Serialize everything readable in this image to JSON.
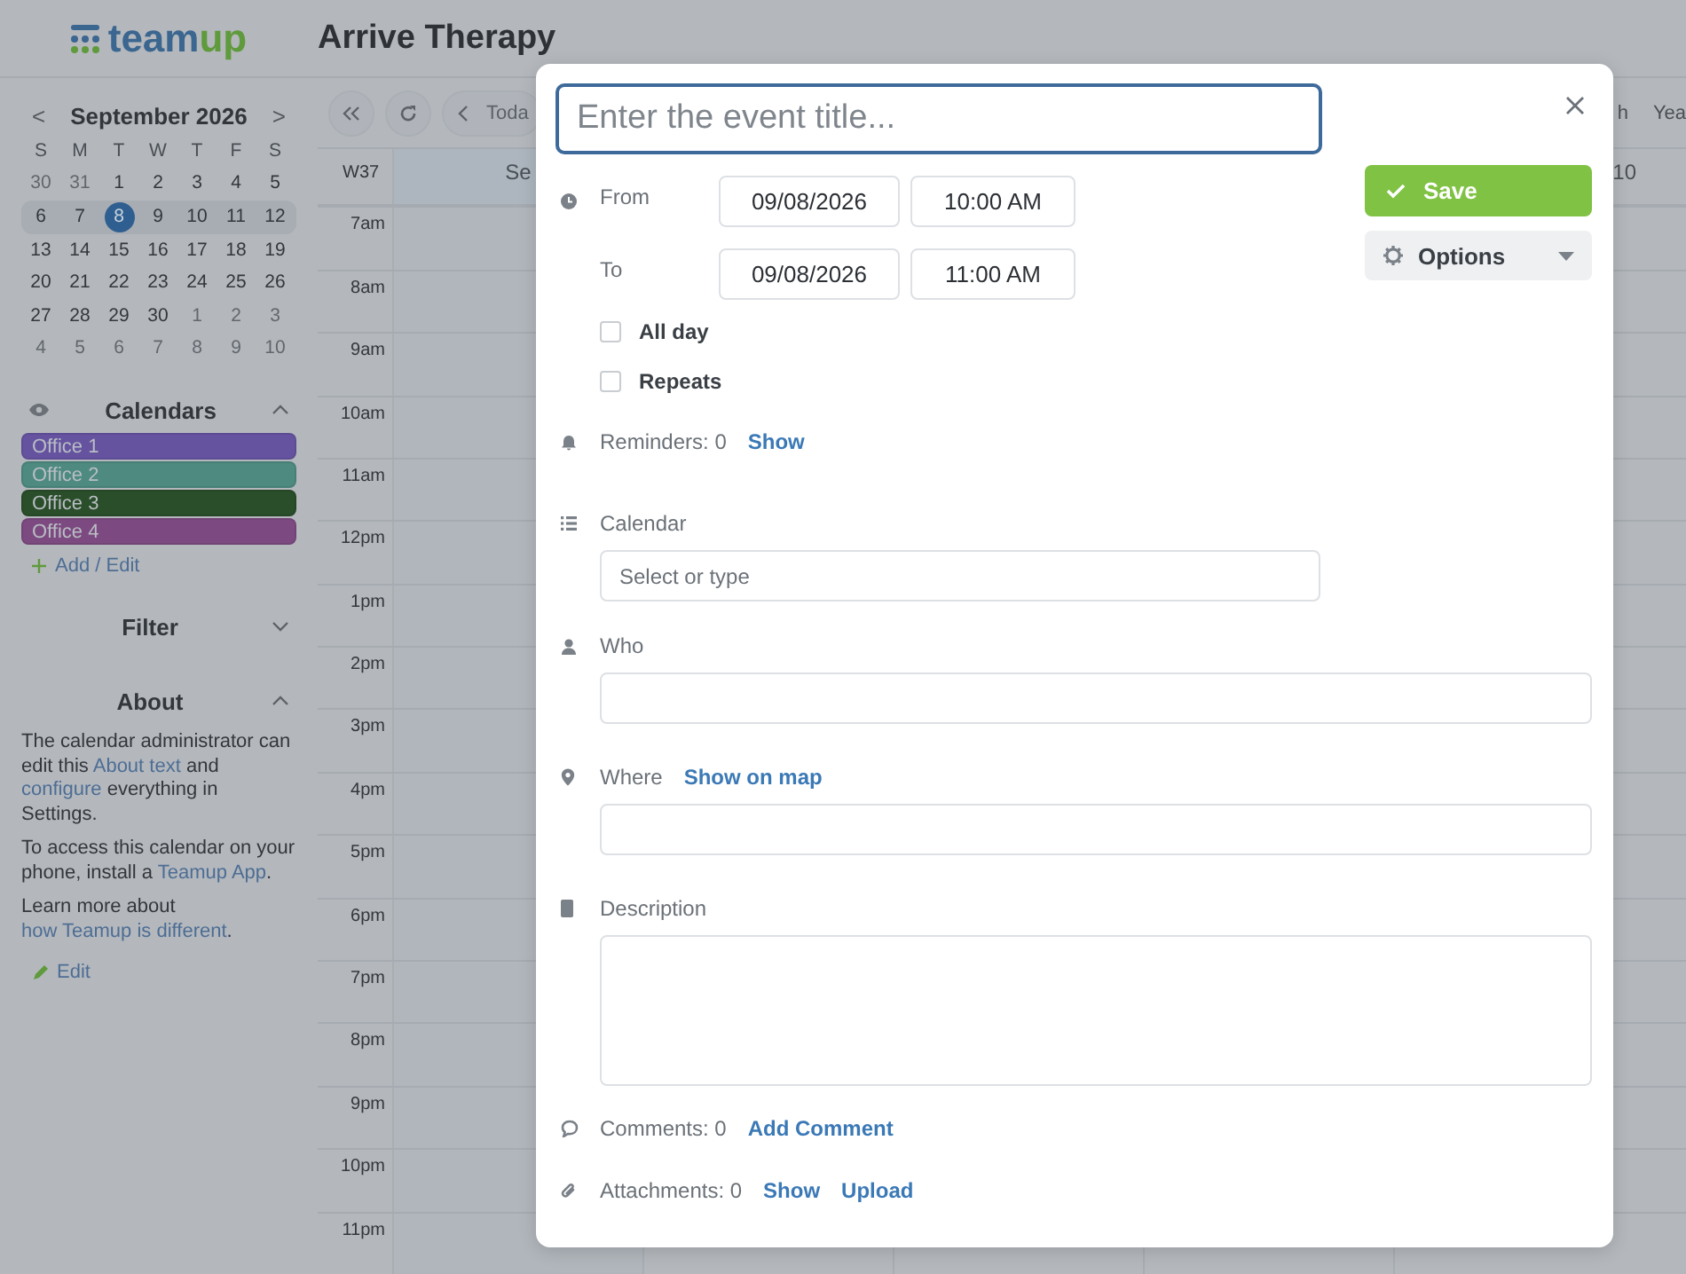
{
  "app": {
    "logo": [
      "team",
      "up"
    ],
    "title": "Arrive Therapy"
  },
  "mini_calendar": {
    "month": "September 2026",
    "prev": "<",
    "next": ">",
    "weekdays": [
      "S",
      "M",
      "T",
      "W",
      "T",
      "F",
      "S"
    ],
    "weeks": [
      {
        "days": [
          {
            "label": "30",
            "outside": true,
            "selected": false
          },
          {
            "label": "31",
            "outside": true,
            "selected": false
          },
          {
            "label": "1",
            "outside": false,
            "selected": false
          },
          {
            "label": "2",
            "outside": false,
            "selected": false
          },
          {
            "label": "3",
            "outside": false,
            "selected": false
          },
          {
            "label": "4",
            "outside": false,
            "selected": false
          },
          {
            "label": "5",
            "outside": false,
            "selected": false
          }
        ]
      },
      {
        "days": [
          {
            "label": "6",
            "outside": false,
            "selected": false
          },
          {
            "label": "7",
            "outside": false,
            "selected": false
          },
          {
            "label": "8",
            "outside": false,
            "selected": true
          },
          {
            "label": "9",
            "outside": false,
            "selected": false
          },
          {
            "label": "10",
            "outside": false,
            "selected": false
          },
          {
            "label": "11",
            "outside": false,
            "selected": false
          },
          {
            "label": "12",
            "outside": false,
            "selected": false
          }
        ]
      },
      {
        "days": [
          {
            "label": "13",
            "outside": false,
            "selected": false
          },
          {
            "label": "14",
            "outside": false,
            "selected": false
          },
          {
            "label": "15",
            "outside": false,
            "selected": false
          },
          {
            "label": "16",
            "outside": false,
            "selected": false
          },
          {
            "label": "17",
            "outside": false,
            "selected": false
          },
          {
            "label": "18",
            "outside": false,
            "selected": false
          },
          {
            "label": "19",
            "outside": false,
            "selected": false
          }
        ]
      },
      {
        "days": [
          {
            "label": "20",
            "outside": false,
            "selected": false
          },
          {
            "label": "21",
            "outside": false,
            "selected": false
          },
          {
            "label": "22",
            "outside": false,
            "selected": false
          },
          {
            "label": "23",
            "outside": false,
            "selected": false
          },
          {
            "label": "24",
            "outside": false,
            "selected": false
          },
          {
            "label": "25",
            "outside": false,
            "selected": false
          },
          {
            "label": "26",
            "outside": false,
            "selected": false
          }
        ]
      },
      {
        "days": [
          {
            "label": "27",
            "outside": false,
            "selected": false
          },
          {
            "label": "28",
            "outside": false,
            "selected": false
          },
          {
            "label": "29",
            "outside": false,
            "selected": false
          },
          {
            "label": "30",
            "outside": false,
            "selected": false
          },
          {
            "label": "1",
            "outside": true,
            "selected": false
          },
          {
            "label": "2",
            "outside": true,
            "selected": false
          },
          {
            "label": "3",
            "outside": true,
            "selected": false
          }
        ]
      },
      {
        "days": [
          {
            "label": "4",
            "outside": true,
            "selected": false
          },
          {
            "label": "5",
            "outside": true,
            "selected": false
          },
          {
            "label": "6",
            "outside": true,
            "selected": false
          },
          {
            "label": "7",
            "outside": true,
            "selected": false
          },
          {
            "label": "8",
            "outside": true,
            "selected": false
          },
          {
            "label": "9",
            "outside": true,
            "selected": false
          },
          {
            "label": "10",
            "outside": true,
            "selected": false
          }
        ]
      }
    ]
  },
  "calendars": {
    "title": "Calendars",
    "expanded": true,
    "items": [
      {
        "name": "Office 1",
        "color": "#6553a0"
      },
      {
        "name": "Office 2",
        "color": "#4e8a80"
      },
      {
        "name": "Office 3",
        "color": "#2a4d2a"
      },
      {
        "name": "Office 4",
        "color": "#7c4a80"
      }
    ],
    "add_link": "Add / Edit"
  },
  "filter": {
    "title": "Filter",
    "expanded": false
  },
  "about": {
    "title": "About",
    "expanded": true,
    "paragraphs": [
      [
        {
          "text": "The calendar administrator can edit this "
        },
        {
          "text": "About text",
          "link": true
        },
        {
          "text": " and "
        },
        {
          "text": "configure",
          "link": true
        },
        {
          "text": " everything in Settings."
        }
      ],
      [
        {
          "text": "To access this calendar on your phone, install a "
        },
        {
          "text": "Teamup App",
          "link": true
        },
        {
          "text": "."
        }
      ],
      [
        {
          "text": "Learn more about "
        },
        {
          "text": "how Teamup is different",
          "link": true
        },
        {
          "text": "."
        }
      ]
    ],
    "edit_link": "Edit"
  },
  "toolbar": {
    "today": "Toda",
    "views": [
      "h",
      "Yea"
    ]
  },
  "grid": {
    "week": "W37",
    "day_headers": [
      "Se",
      "10"
    ],
    "hours": [
      "7am",
      "8am",
      "9am",
      "10am",
      "11am",
      "12pm",
      "1pm",
      "2pm",
      "3pm",
      "4pm",
      "5pm",
      "6pm",
      "7pm",
      "8pm",
      "9pm",
      "10pm",
      "11pm"
    ]
  },
  "dialog": {
    "title_field": {
      "placeholder": "Enter the event title..."
    },
    "from": {
      "label": "From",
      "date": "09/08/2026",
      "time": "10:00 AM"
    },
    "to": {
      "label": "To",
      "date": "09/08/2026",
      "time": "11:00 AM"
    },
    "checkboxes": [
      {
        "label": "All day",
        "checked": false
      },
      {
        "label": "Repeats",
        "checked": false
      }
    ],
    "reminders": {
      "label": "Reminders: 0",
      "link": "Show"
    },
    "save": "Save",
    "options": "Options",
    "calendar": {
      "label": "Calendar",
      "placeholder": "Select or type"
    },
    "who": {
      "label": "Who"
    },
    "where": {
      "label": "Where",
      "link": "Show on map"
    },
    "description": {
      "label": "Description"
    },
    "comments": {
      "label": "Comments: 0",
      "links": [
        "Add Comment"
      ]
    },
    "attachments": {
      "label": "Attachments: 0",
      "links": [
        "Show",
        "Upload"
      ]
    }
  }
}
